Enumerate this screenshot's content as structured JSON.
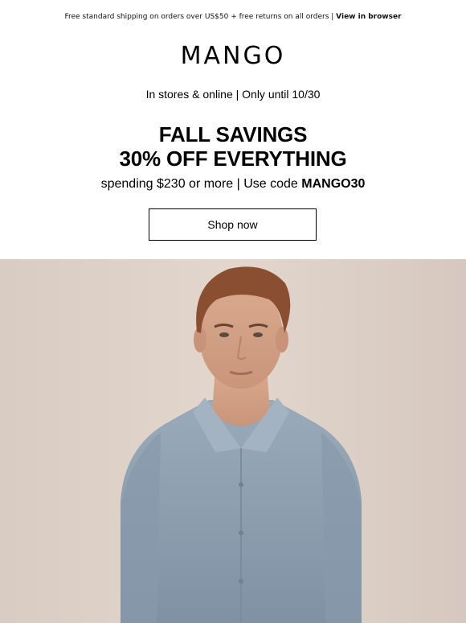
{
  "top_bar": {
    "shipping_text": "Free standard shipping on orders over US$50 + free returns on all orders | ",
    "view_in_browser": "View in browser"
  },
  "brand": {
    "logo_text": "MANGO"
  },
  "promo": {
    "availability": "In stores & online | Only until 10/30",
    "headline_line1": "FALL SAVINGS",
    "headline_line2": "30% OFF EVERYTHING",
    "conditions_prefix": "spending $230 or more | Use code ",
    "promo_code": "MANGO30",
    "cta_label": "Shop now"
  },
  "hero": {
    "image_subject": "man-in-blue-shirt-photo"
  },
  "colors": {
    "background": "#ffffff",
    "text": "#000000",
    "hero_backdrop": "#dccfc5",
    "shirt": "#8ea0b0"
  }
}
